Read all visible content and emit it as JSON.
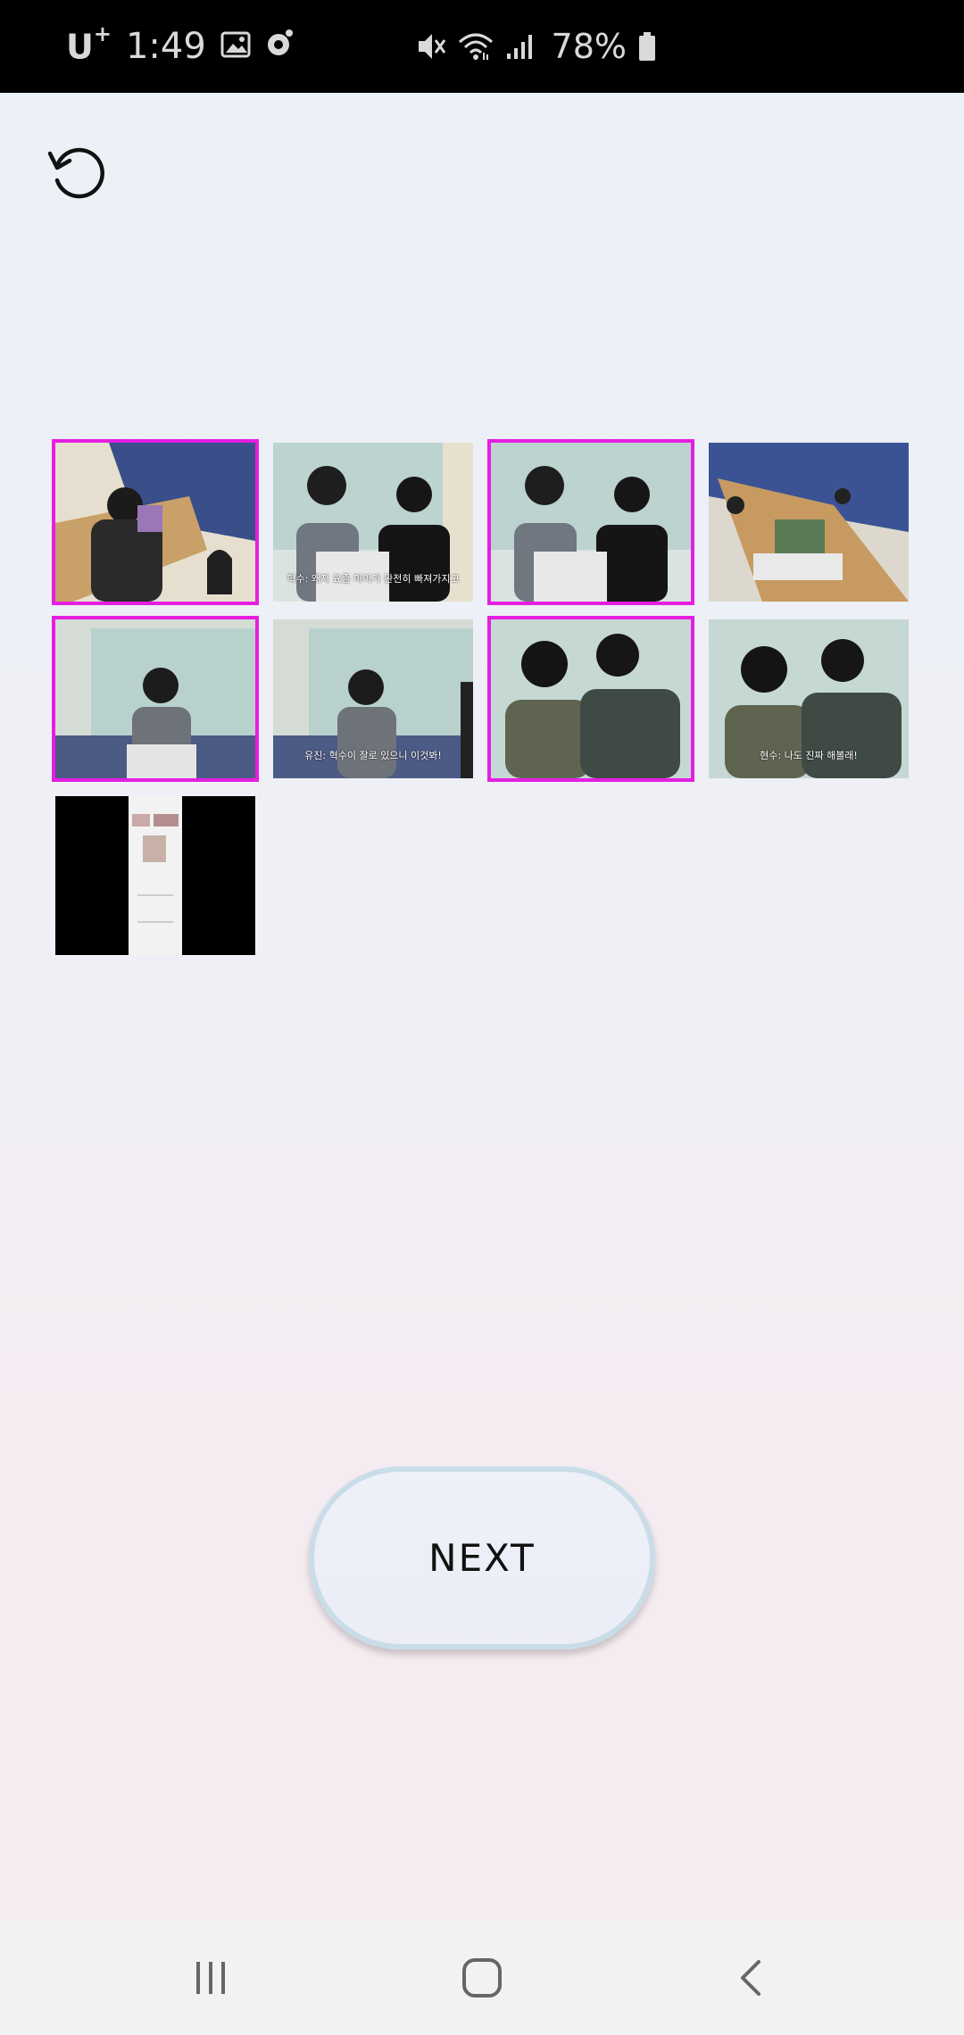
{
  "status_bar": {
    "carrier": "U",
    "carrier_sup": "+",
    "time": "1:49",
    "battery": "78%"
  },
  "thumbnails": [
    {
      "id": 1,
      "selected": true,
      "caption": ""
    },
    {
      "id": 2,
      "selected": false,
      "caption": "혁수: 왜지 요즘 마이가 완전히 빠져가지고"
    },
    {
      "id": 3,
      "selected": true,
      "caption": ""
    },
    {
      "id": 4,
      "selected": false,
      "caption": ""
    },
    {
      "id": 5,
      "selected": true,
      "caption": ""
    },
    {
      "id": 6,
      "selected": false,
      "caption": "유진: 혁수이 잘로 있으니 이것봐!"
    },
    {
      "id": 7,
      "selected": true,
      "caption": ""
    },
    {
      "id": 8,
      "selected": false,
      "caption": "현수: 나도 진짜 해볼래!"
    },
    {
      "id": 9,
      "selected": false,
      "caption": ""
    }
  ],
  "buttons": {
    "next_label": "NEXT"
  },
  "colors": {
    "selection": "#e51ee1",
    "button_border": "#c9dde9"
  }
}
